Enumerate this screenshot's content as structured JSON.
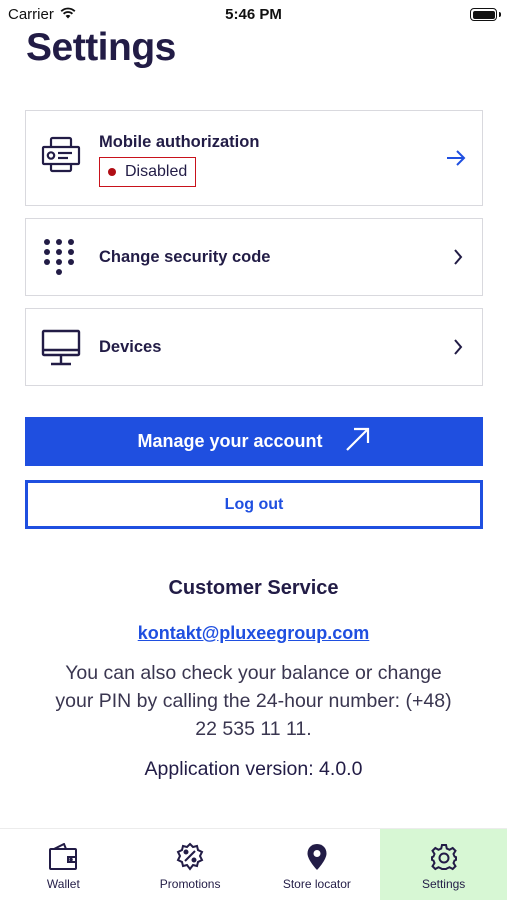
{
  "status_bar": {
    "carrier": "Carrier",
    "time": "5:46 PM"
  },
  "page": {
    "title": "Settings"
  },
  "settings_items": [
    {
      "label": "Mobile authorization",
      "status": "Disabled",
      "icon": "phone-id-icon"
    },
    {
      "label": "Change security code",
      "icon": "keypad-icon"
    },
    {
      "label": "Devices",
      "icon": "monitor-icon"
    }
  ],
  "actions": {
    "manage_account": "Manage your account",
    "logout": "Log out"
  },
  "customer_service": {
    "title": "Customer Service",
    "email": "kontakt@pluxeegroup.com",
    "info_line1": "You can also check your balance or change",
    "info_line2": "your PIN by calling the 24-hour number: (+48)",
    "info_line3": "22 535 11 11.",
    "app_version": "Application version: 4.0.0"
  },
  "tab_bar": {
    "tabs": [
      {
        "label": "Wallet",
        "icon": "wallet-icon"
      },
      {
        "label": "Promotions",
        "icon": "promotions-icon"
      },
      {
        "label": "Store locator",
        "icon": "location-pin-icon"
      },
      {
        "label": "Settings",
        "icon": "gear-icon"
      }
    ],
    "active": "Settings"
  },
  "colors": {
    "primary": "#1f4fe0",
    "text_dark": "#221c46",
    "danger": "#c8121b",
    "active_tab": "#d7f7d4"
  }
}
